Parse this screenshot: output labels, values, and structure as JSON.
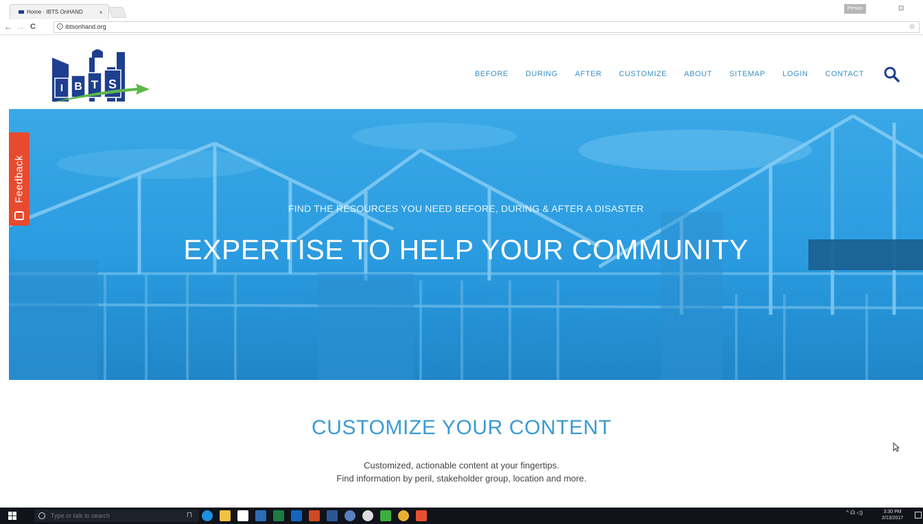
{
  "browser": {
    "tab_title": "Home · IBTS OnHAND",
    "tab_close": "×",
    "url": "ibtsonhand.org",
    "nav_back": "←",
    "nav_forward": "→",
    "nav_reload": "C",
    "star": "☆",
    "window_user": "Person",
    "window_btn": "⊡"
  },
  "logo": {
    "letters": [
      "I",
      "B",
      "T",
      "S"
    ]
  },
  "nav": {
    "items": [
      {
        "label": "BEFORE"
      },
      {
        "label": "DURING"
      },
      {
        "label": "AFTER"
      },
      {
        "label": "CUSTOMIZE"
      },
      {
        "label": "ABOUT"
      },
      {
        "label": "SITEMAP"
      },
      {
        "label": "LOGIN"
      },
      {
        "label": "CONTACT"
      }
    ]
  },
  "hero": {
    "subtitle": "FIND THE RESOURCES YOU NEED BEFORE, DURING & AFTER A DISASTER",
    "title": "EXPERTISE TO HELP YOUR COMMUNITY"
  },
  "feedback": {
    "label": "Feedback"
  },
  "content": {
    "title": "CUSTOMIZE YOUR CONTENT",
    "line1": "Customized, actionable content at your fingertips.",
    "line2": "Find information by peril, stakeholder group, location and more."
  },
  "taskbar": {
    "search_placeholder": "Type or talk to search",
    "time": "3:30 PM",
    "date": "2/13/2017",
    "tray": "^ ☊ ◁)"
  },
  "colors": {
    "accent": "#3b8fc4",
    "hero": "#2a9fe0",
    "feedback": "#e84a2f",
    "logo_blue": "#1e3f8f",
    "logo_green": "#5cb84a"
  }
}
